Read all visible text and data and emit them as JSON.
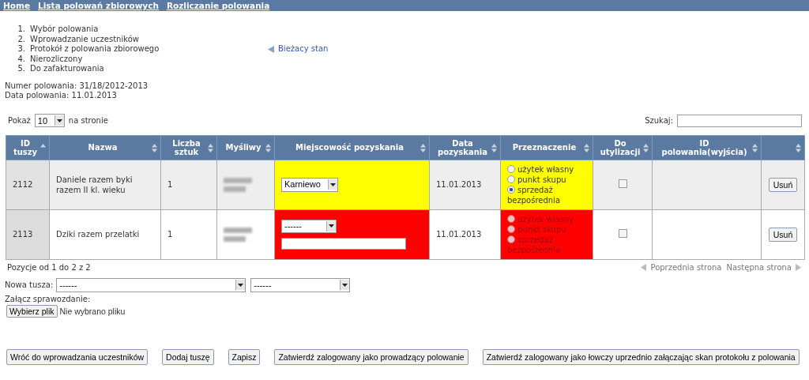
{
  "nav": [
    "Home",
    "Lista polowań zbiorowych",
    "Rozliczanie polowania"
  ],
  "steps": [
    {
      "number": "1.",
      "label": "Wybór polowania"
    },
    {
      "number": "2.",
      "label": "Wprowadzanie uczestników"
    },
    {
      "number": "3.",
      "label": "Protokół z polowania zbiorowego",
      "current": true
    },
    {
      "number": "4.",
      "label": "Nierozliczony"
    },
    {
      "number": "5.",
      "label": "Do zafakturowania"
    }
  ],
  "current_label": "Bieżacy stan",
  "info": [
    "Numer polowania: 31/18/2012-2013",
    "Data polowania: 11.01.2013"
  ],
  "length": {
    "before": "Pokaż",
    "value": "10",
    "after": "na stronie"
  },
  "search": {
    "label": "Szukaj:"
  },
  "table": {
    "columns": [
      {
        "label": "ID tuszy",
        "sorted": true
      },
      {
        "label": "Nazwa",
        "sorted": false
      },
      {
        "label": "Liczba sztuk",
        "sorted": false
      },
      {
        "label": "Myśliwy",
        "sorted": false
      },
      {
        "label": "Miejscowość pozyskania",
        "sorted": false
      },
      {
        "label": "Data pozyskania",
        "sorted": false
      },
      {
        "label": "Przeznaczenie",
        "sorted": false
      },
      {
        "label": "Do utylizacji",
        "sorted": false
      },
      {
        "label": "ID polowania(wyjścia)",
        "sorted": false
      },
      {
        "sorted": false
      }
    ],
    "rows": [
      {
        "id": "2112",
        "name": "Daniele razem byki razem II kl. wieku",
        "count": "1",
        "color": "#ffff00",
        "place": {
          "value": "Karniewo",
          "text_field": false
        },
        "date": "11.01.2013",
        "purpose_disabled": false,
        "purpose": [
          {
            "label": "użytek własny",
            "selected": false
          },
          {
            "label": "punkt skupu",
            "selected": false
          },
          {
            "label": "sprzedaż bezpośrednia",
            "selected": true
          }
        ],
        "disposal": false,
        "delete": "Usuń"
      },
      {
        "id": "2113",
        "name": "Dziki razem przelatki",
        "count": "1",
        "color": "#ff0000",
        "place": {
          "value": "------",
          "text_field": true
        },
        "date": "11.01.2013",
        "purpose_disabled": true,
        "purpose": [
          {
            "label": "użytek własny",
            "selected": false
          },
          {
            "label": "punkt skupu",
            "selected": false
          },
          {
            "label": "sprzedaż bezpośrednia",
            "selected": false
          }
        ],
        "disposal": false,
        "delete": "Usuń"
      }
    ]
  },
  "table_info": "Pozycje od 1 do 2 z 2",
  "pager": {
    "previous": "Poprzednia strona",
    "next": "Następna strona"
  },
  "new_carcass": {
    "label": "Nowa tusza:",
    "selects": [
      "------",
      "------"
    ]
  },
  "attach": {
    "label": "Załącz sprawozdanie:",
    "button": "Wybierz plik",
    "status": "Nie wybrano pliku"
  },
  "buttons": [
    "Wróć do wprowadzania uczestników",
    "Dodaj tuszę",
    "Zapisz",
    "Zatwierdź zalogowany jako prowadzący polowanie",
    "Zatwierdź zalogowany jako łowczy uprzednio załączając skan protokołu z polowania"
  ]
}
